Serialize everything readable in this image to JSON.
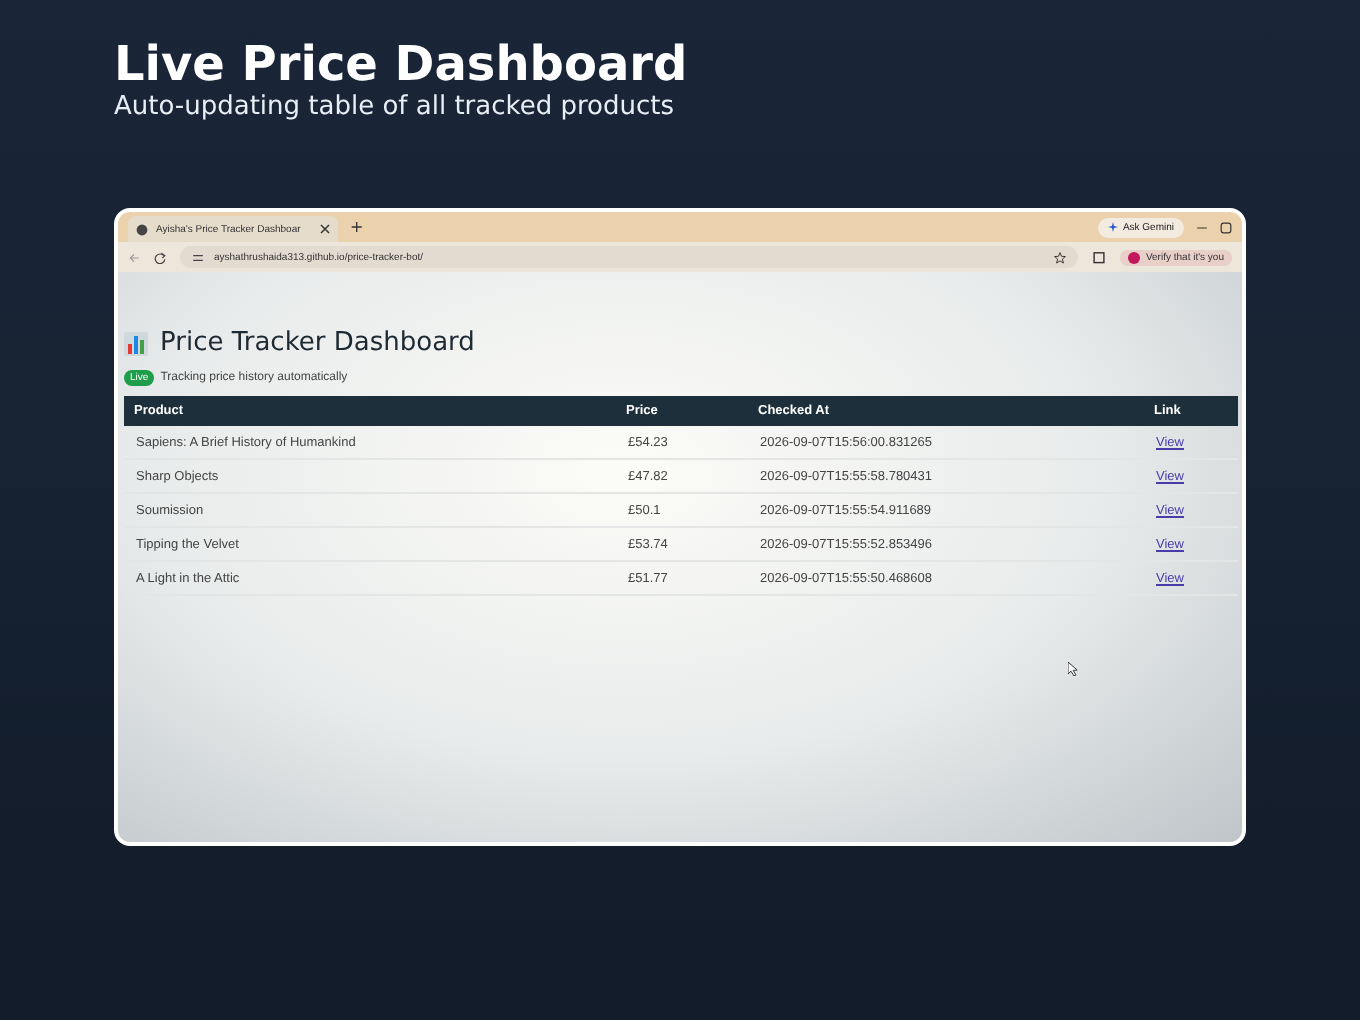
{
  "slide": {
    "title": "Live Price Dashboard",
    "subtitle": "Auto-updating table of all tracked products"
  },
  "browser": {
    "tab": {
      "title": "Ayisha's Price Tracker Dashboar",
      "selected": true
    },
    "new_tab": "+",
    "ask_button": "Ask Gemini",
    "url": "ayshathrushaida313.github.io/price-tracker-bot/",
    "profile_chip": "Verify that it's you"
  },
  "page": {
    "title": "Price Tracker Dashboard",
    "badge": "Live",
    "status": "Tracking price history automatically",
    "table": {
      "columns": [
        "Product",
        "Price",
        "Checked At",
        "Link"
      ],
      "rows": [
        {
          "product": "Sapiens: A Brief History of Humankind",
          "price": "£54.23",
          "checked_at": "2026-09-07T15:56:00.831265",
          "link": "View"
        },
        {
          "product": "Sharp Objects",
          "price": "£47.82",
          "checked_at": "2026-09-07T15:55:58.780431",
          "link": "View"
        },
        {
          "product": "Soumission",
          "price": "£50.1",
          "checked_at": "2026-09-07T15:55:54.911689",
          "link": "View"
        },
        {
          "product": "Tipping the Velvet",
          "price": "£53.74",
          "checked_at": "2026-09-07T15:55:52.853496",
          "link": "View"
        },
        {
          "product": "A Light in the Attic",
          "price": "£51.77",
          "checked_at": "2026-09-07T15:55:50.468608",
          "link": "View"
        }
      ]
    }
  }
}
